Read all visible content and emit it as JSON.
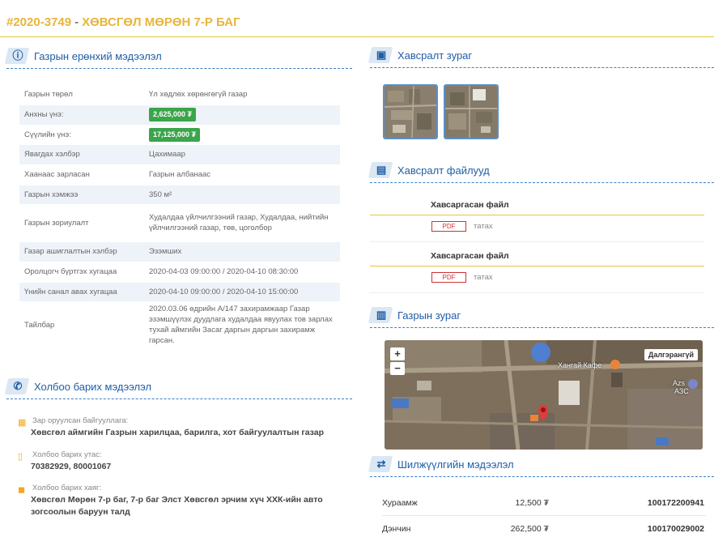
{
  "header": {
    "code": "#2020-3749",
    "separator": "-",
    "location": "ХӨВСГӨЛ МӨРӨН 7-Р БАГ"
  },
  "general": {
    "section_title": "Газрын ерөнхий мэдээлэл",
    "rows": [
      {
        "key": "Газрын төрөл",
        "value": "Үл хөдлөх хөрөнгөгүй газар"
      },
      {
        "key": "Анхны үнэ:",
        "value": "2,625,000 ₮"
      },
      {
        "key": "Сүүлийн үнэ:",
        "value": "17,125,000 ₮"
      },
      {
        "key": "Явагдах хэлбэр",
        "value": "Цахимаар"
      },
      {
        "key": "Хаанаас зарласан",
        "value": "Газрын албанаас"
      },
      {
        "key": "Газрын хэмжээ",
        "value": "350 м²"
      },
      {
        "key": "Газрын зориулалт",
        "value": "Худалдаа үйлчилгээний газар, Худалдаа, нийтийн үйлчилгээний газар, төв, цоголбор"
      },
      {
        "key": "Газар ашиглалтын хэлбэр",
        "value": "Эзэмших"
      },
      {
        "key": "Оролцогч бүртгэх хугацаа",
        "value": "2020-04-03 09:00:00 / 2020-04-10 08:30:00"
      },
      {
        "key": "Үнийн санал авах хугацаа",
        "value": "2020-04-10 09:00:00 / 2020-04-10 15:00:00"
      },
      {
        "key": "Тайлбар",
        "value": "2020.03.06 өдрийн А/147 захирамжаар Газар эзэмшүүлэх дуудлага худалдаа явуулах тов зарлах тухай аймгийн Засаг даргын даргын захирамж гарсан."
      }
    ]
  },
  "contact": {
    "section_title": "Холбоо барих мэдээлэл",
    "org_label": "Зар оруулсан байгууллага:",
    "org_value": "Хөвсгөл аймгийн Газрын харилцаа, барилга, хот байгуулалтын газар",
    "phone_label": "Холбоо барих утас:",
    "phone_value": "70382929, 80001067",
    "address_label": "Холбоо барих хаяг:",
    "address_value": "Хөвсгөл Мөрөн 7-р баг, 7-р баг Элст Хөвсгөл эрчим хүч ХХК-ийн авто зогсоолын баруун талд"
  },
  "attachments_img": {
    "section_title": "Хавсралт зураг"
  },
  "attachments_files": {
    "section_title": "Хавсралт файлууд",
    "files": [
      {
        "title": "Хавсаргасан файл",
        "type": "PDF",
        "action": "татах"
      },
      {
        "title": "Хавсаргасан файл",
        "type": "PDF",
        "action": "татах"
      }
    ]
  },
  "map": {
    "section_title": "Газрын зураг",
    "zoom_in": "+",
    "zoom_out": "−",
    "map_type": "Далгэрангүй",
    "place_cafe": "Хангай Кафе",
    "place_azs": "Azs",
    "place_azs2": "АЗС"
  },
  "transfer": {
    "section_title": "Шилжүүлгийн мэдээлэл",
    "rows": [
      {
        "name": "Хураамж",
        "amount": "12,500 ₮",
        "account": "100172200941"
      },
      {
        "name": "Дэнчин",
        "amount": "262,500 ₮",
        "account": "100170029002"
      }
    ]
  },
  "colors": {
    "accent_gold": "#e8b53a",
    "accent_blue": "#1f5ea8",
    "price_green": "#3aa54a",
    "pdf_red": "#cc3333"
  },
  "icons": [
    "info-icon",
    "phone-icon",
    "image-icon",
    "file-icon",
    "map-icon",
    "transfer-icon",
    "building-icon",
    "mobile-icon",
    "pin-icon"
  ]
}
